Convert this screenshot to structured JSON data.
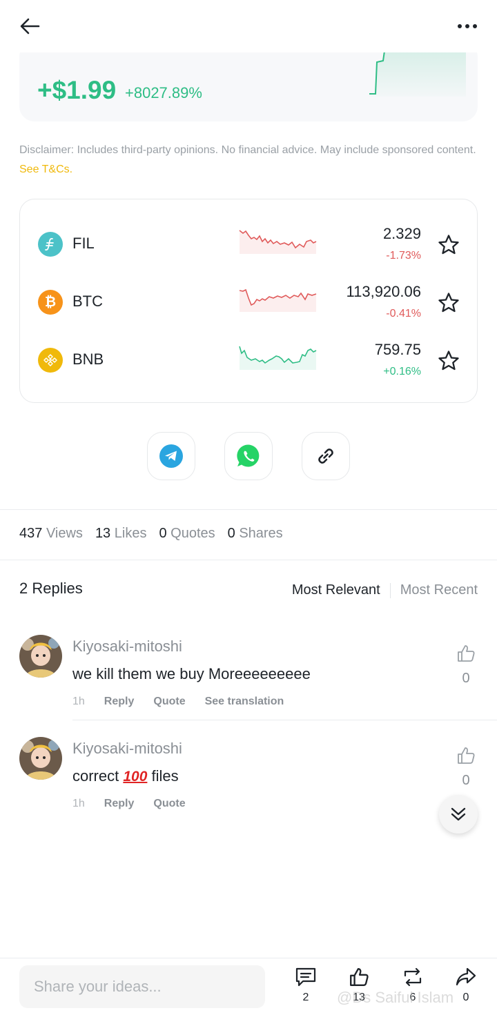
{
  "pnl": {
    "amount": "+$1.99",
    "percent": "+8027.89%"
  },
  "disclaimer": {
    "text": "Disclaimer: Includes third-party opinions. No financial advice. May include sponsored content. ",
    "link": "See T&Cs."
  },
  "coins": [
    {
      "symbol": "FIL",
      "price": "2.329",
      "change": "-1.73%",
      "direction": "down",
      "icon": "filecoin-icon",
      "color": "#4cc2c8"
    },
    {
      "symbol": "BTC",
      "price": "113,920.06",
      "change": "-0.41%",
      "direction": "down",
      "icon": "bitcoin-icon",
      "color": "#f7931a"
    },
    {
      "symbol": "BNB",
      "price": "759.75",
      "change": "+0.16%",
      "direction": "up",
      "icon": "bnb-icon",
      "color": "#f0b90b"
    }
  ],
  "share": {
    "telegram": "telegram-icon",
    "whatsapp": "whatsapp-icon",
    "link": "link-icon"
  },
  "stats": {
    "views_count": "437",
    "views_label": "Views",
    "likes_count": "13",
    "likes_label": "Likes",
    "quotes_count": "0",
    "quotes_label": "Quotes",
    "shares_count": "0",
    "shares_label": "Shares"
  },
  "replies": {
    "title": "2 Replies",
    "sort_relevant": "Most Relevant",
    "sort_recent": "Most Recent",
    "items": [
      {
        "user": "Kiyosaki-mitoshi",
        "text": "we kill them we buy Moreeeeeeeee",
        "time": "1h",
        "reply": "Reply",
        "quote": "Quote",
        "translate": "See translation",
        "likes": "0"
      },
      {
        "user": "Kiyosaki-mitoshi",
        "text_before": "correct ",
        "emoji": "100",
        "text_after": " files",
        "time": "1h",
        "reply": "Reply",
        "quote": "Quote",
        "likes": "0"
      }
    ]
  },
  "bottom": {
    "placeholder": "Share your ideas...",
    "comments": "2",
    "likes": "13",
    "reposts": "6",
    "shares": "0",
    "watermark": "@Ds Saiful Islam"
  },
  "colors": {
    "up": "#2ebd85",
    "down": "#e05a5a",
    "accent": "#f0b90b"
  }
}
